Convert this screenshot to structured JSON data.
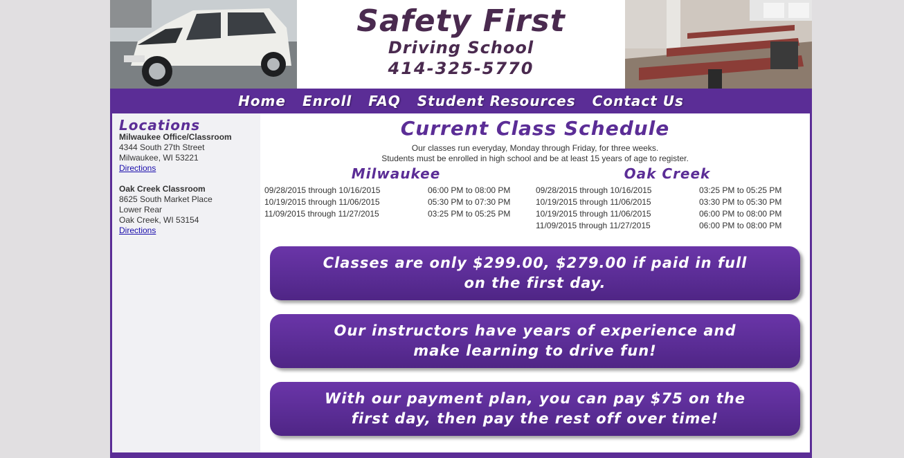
{
  "header": {
    "title": "Safety First",
    "subtitle": "Driving School",
    "phone": "414-325-5770"
  },
  "nav": [
    "Home",
    "Enroll",
    "FAQ",
    "Student Resources",
    "Contact Us"
  ],
  "sidebar": {
    "heading": "Locations",
    "locations": [
      {
        "name": "Milwaukee Office/Classroom",
        "lines": [
          "4344 South 27th Street",
          "Milwaukee, WI 53221"
        ],
        "link": "Directions"
      },
      {
        "name": "Oak Creek Classroom",
        "lines": [
          "8625 South Market Place",
          "Lower Rear",
          "Oak Creek, WI 53154"
        ],
        "link": "Directions"
      }
    ]
  },
  "main": {
    "title": "Current Class Schedule",
    "intro": [
      "Our classes run everyday, Monday through Friday, for three weeks.",
      "Students must be enrolled in high school and be at least 15 years of age to register."
    ],
    "schedules": [
      {
        "city": "Milwaukee",
        "rows": [
          {
            "dates": "09/28/2015 through 10/16/2015",
            "time": "06:00 PM to 08:00 PM"
          },
          {
            "dates": "10/19/2015 through 11/06/2015",
            "time": "05:30 PM to 07:30 PM"
          },
          {
            "dates": "11/09/2015 through 11/27/2015",
            "time": "03:25 PM to 05:25 PM"
          }
        ]
      },
      {
        "city": "Oak Creek",
        "rows": [
          {
            "dates": "09/28/2015 through 10/16/2015",
            "time": "03:25 PM to 05:25 PM"
          },
          {
            "dates": "10/19/2015 through 11/06/2015",
            "time": "03:30 PM to 05:30 PM"
          },
          {
            "dates": "10/19/2015 through 11/06/2015",
            "time": "06:00 PM to 08:00 PM"
          },
          {
            "dates": "11/09/2015 through 11/27/2015",
            "time": "06:00 PM to 08:00 PM"
          }
        ]
      }
    ],
    "promos": [
      [
        "Classes are only $299.00, $279.00 if paid in full",
        "on the first day."
      ],
      [
        "Our instructors have years of experience and",
        "make learning to drive fun!"
      ],
      [
        "With our payment plan, you can pay $75 on the",
        "first day, then pay the rest off over time!"
      ]
    ]
  },
  "colors": {
    "brand": "#5b2d96",
    "logo": "#4a2a4f"
  }
}
